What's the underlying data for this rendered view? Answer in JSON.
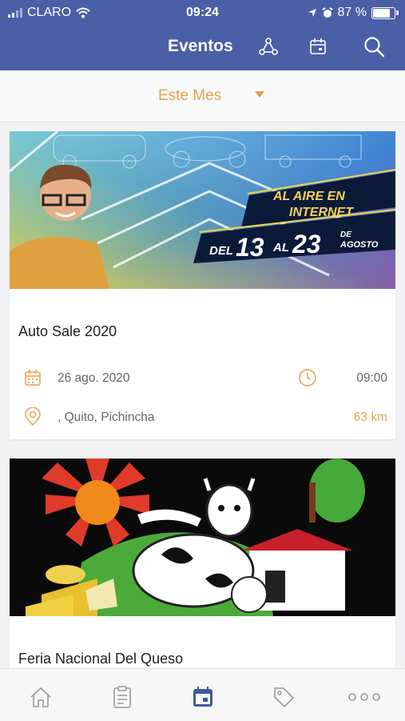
{
  "status_bar": {
    "carrier": "CLARO",
    "time": "09:24",
    "battery": "87 %",
    "battery_level": 0.87
  },
  "header": {
    "title": "Eventos",
    "icons": [
      "share-icon",
      "calendar-icon",
      "search-icon"
    ]
  },
  "filter": {
    "label": "Este Mes"
  },
  "events": [
    {
      "banner": {
        "line1": "AL AIRE EN",
        "line2": "INTERNET",
        "del": "DEL",
        "from": "13",
        "al": "AL",
        "to": "23",
        "de": "DE",
        "month": "AGOSTO"
      },
      "name": "Auto Sale 2020",
      "date": "26 ago. 2020",
      "time": "09:00",
      "location": ", Quito, Pichincha",
      "distance": "63 km"
    },
    {
      "name": "Feria Nacional Del Queso"
    }
  ],
  "tab_bar": {
    "tabs": [
      "home-icon",
      "clipboard-icon",
      "calendar-icon",
      "tag-icon",
      "more-icon"
    ],
    "active": "calendar-icon"
  },
  "colors": {
    "header": "#4a5fa6",
    "accent": "#e4a24a",
    "tab_active": "#3d5aa0"
  }
}
